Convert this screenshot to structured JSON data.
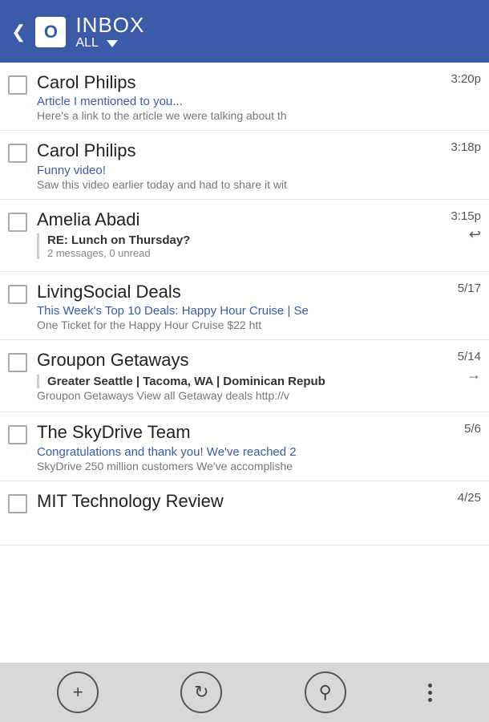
{
  "header": {
    "back_label": "❮",
    "outlook_label": "O",
    "title": "INBOX",
    "subtitle": "ALL"
  },
  "emails": [
    {
      "sender": "Carol Philips",
      "subject": "Article I mentioned to you...",
      "preview": "Here's a link to the article we were talking about th",
      "time": "3:20p",
      "is_thread": false,
      "thread_subject": "",
      "thread_info": "",
      "arrow": ""
    },
    {
      "sender": "Carol Philips",
      "subject": "Funny video!",
      "preview": "Saw this video earlier today and had to share it wit",
      "time": "3:18p",
      "is_thread": false,
      "thread_subject": "",
      "thread_info": "",
      "arrow": ""
    },
    {
      "sender": "Amelia Abadi",
      "subject": "",
      "preview": "",
      "time": "3:15p",
      "is_thread": true,
      "thread_subject": "RE: Lunch on Thursday?",
      "thread_info": "2 messages, 0 unread",
      "arrow": "↩"
    },
    {
      "sender": "LivingSocial Deals",
      "subject": "This Week's Top 10 Deals: Happy Hour Cruise | Se",
      "preview": "One Ticket for the Happy Hour Cruise   $22   htt",
      "time": "5/17",
      "is_thread": false,
      "thread_subject": "",
      "thread_info": "",
      "arrow": ""
    },
    {
      "sender": "Groupon Getaways",
      "subject": "",
      "preview": "Groupon Getaways View all Getaway deals http://v",
      "time": "5/14",
      "is_thread": false,
      "thread_subject": "Greater Seattle | Tacoma, WA | Dominican Repub",
      "thread_info": "",
      "arrow": "→"
    },
    {
      "sender": "The SkyDrive Team",
      "subject": "Congratulations and thank you! We've reached 2",
      "preview": "SkyDrive 250 million customers We've accomplishe",
      "time": "5/6",
      "is_thread": false,
      "thread_subject": "",
      "thread_info": "",
      "arrow": ""
    },
    {
      "sender": "MIT Technology Review",
      "subject": "",
      "preview": "",
      "time": "4/25",
      "is_thread": false,
      "thread_subject": "",
      "thread_info": "",
      "arrow": ""
    }
  ],
  "toolbar": {
    "add_label": "+",
    "refresh_label": "⟳",
    "search_label": "⌕"
  }
}
